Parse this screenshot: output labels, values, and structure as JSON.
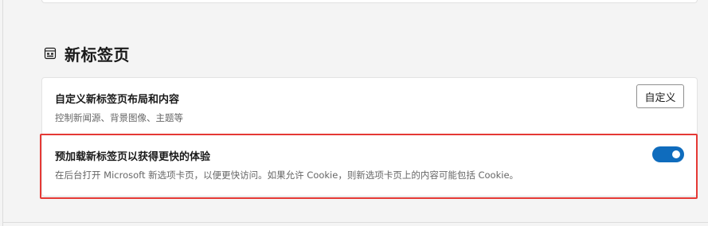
{
  "section": {
    "icon": "new-tab-page-icon",
    "title": "新标签页"
  },
  "customize_row": {
    "title": "自定义新标签页布局和内容",
    "subtitle": "控制新闻源、背景图像、主题等",
    "button_label": "自定义"
  },
  "preload_row": {
    "title": "预加载新标签页以获得更快的体验",
    "subtitle": "在后台打开 Microsoft 新选项卡页，以便更快访问。如果允许 Cookie，则新选项卡页上的内容可能包括 Cookie。",
    "toggle_on": true
  },
  "colors": {
    "accent": "#0f6cbd",
    "highlight": "#e53935"
  }
}
